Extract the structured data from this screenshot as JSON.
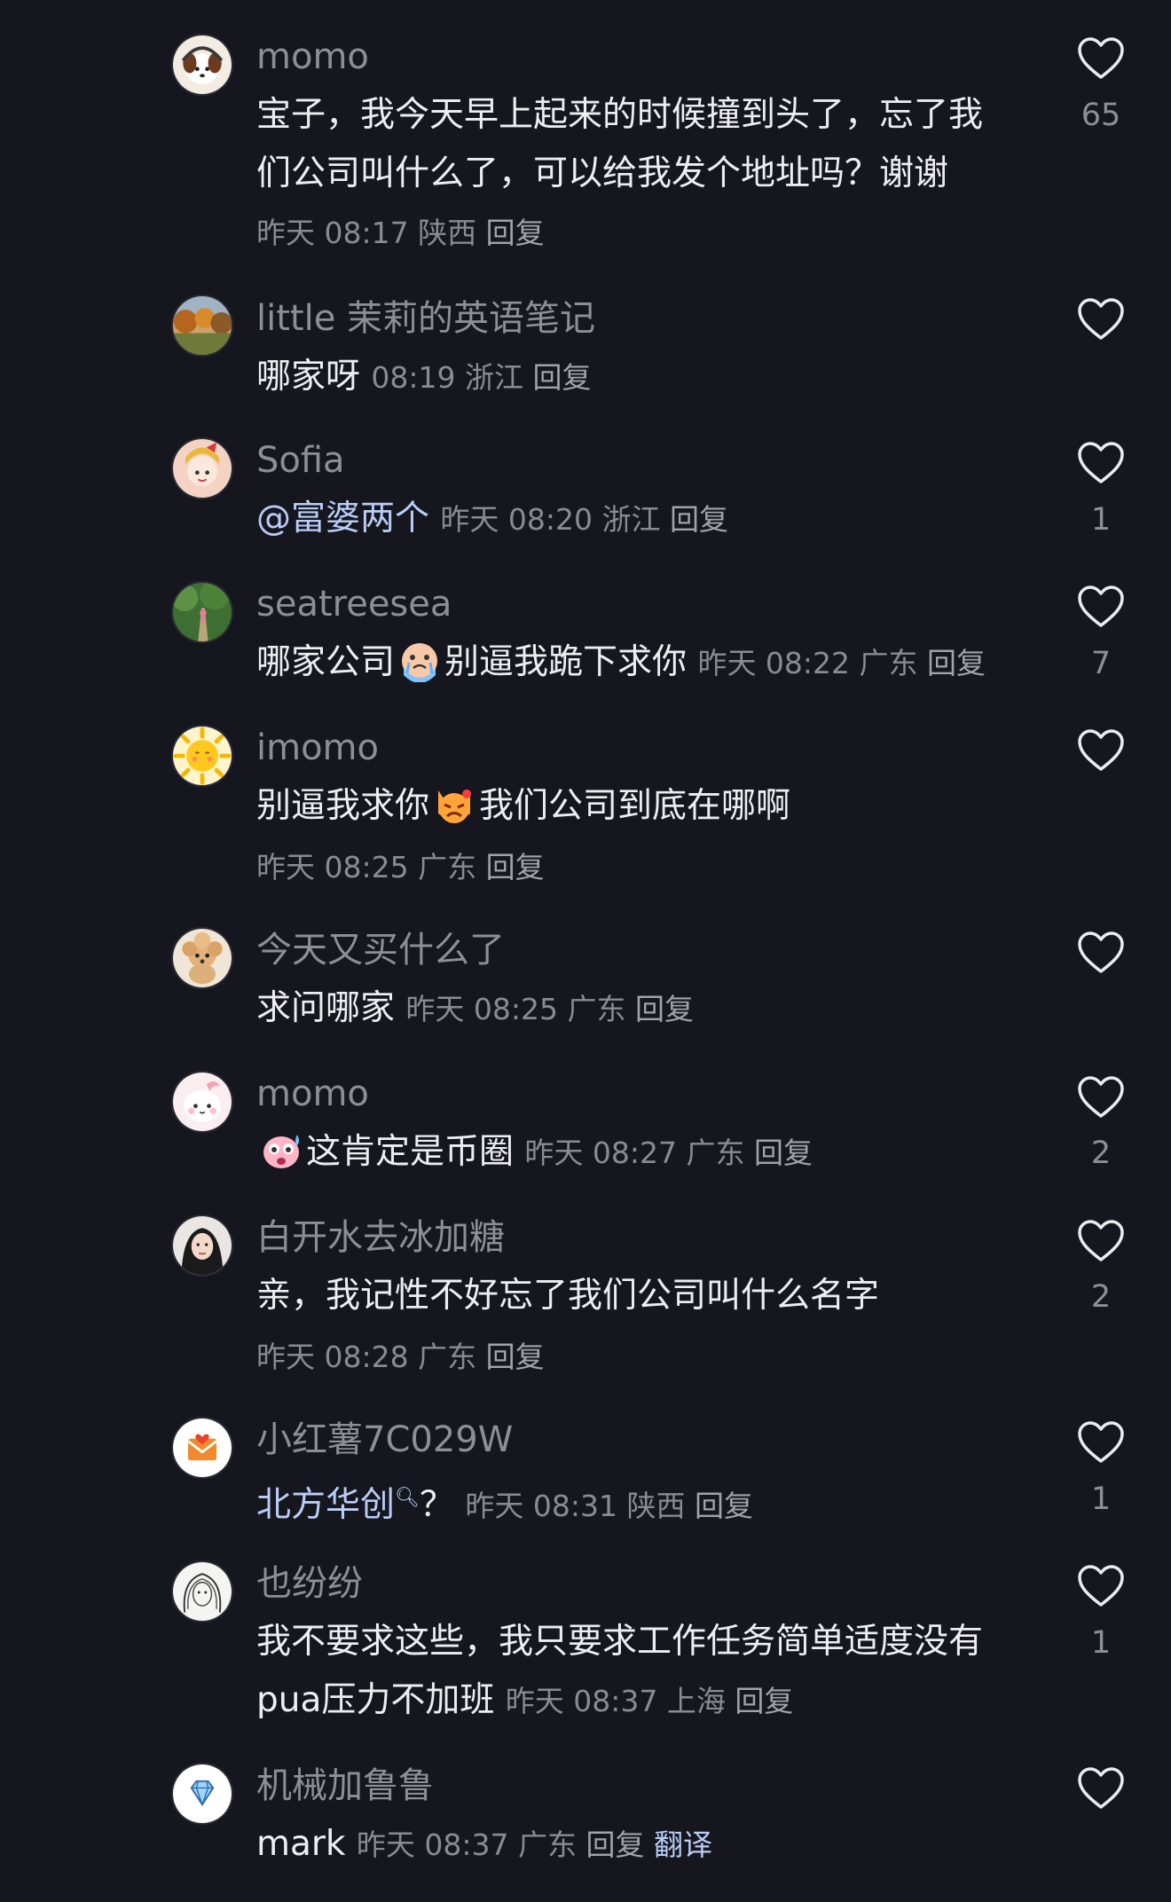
{
  "comments": [
    {
      "username": "momo",
      "text": "宝子，我今天早上起来的时候撞到头了，忘了我们公司叫什么了，可以给我发个地址吗？谢谢",
      "time": "昨天 08:17",
      "location": "陕西",
      "reply": "回复",
      "likes": "65",
      "avatar": "puppy-headphones-avatar"
    },
    {
      "username": "little 茉莉的英语笔记",
      "text": "哪家呀",
      "time": "08:19",
      "location": "浙江",
      "reply": "回复",
      "likes": "",
      "avatar": "autumn-forest-avatar"
    },
    {
      "username": "Sofia",
      "mention": "@富婆两个",
      "time": "昨天 08:20",
      "location": "浙江",
      "reply": "回复",
      "likes": "1",
      "avatar": "cartoon-girl-avatar"
    },
    {
      "username": "seatreesea",
      "text_before": "哪家公司",
      "emoji": "crying-emoji",
      "text_after": "别逼我跪下求你",
      "time": "昨天 08:22",
      "location": "广东",
      "reply": "回复",
      "likes": "7",
      "avatar": "forest-path-avatar"
    },
    {
      "username": "imomo",
      "text_before": "别逼我求你",
      "emoji": "angry-cat-emoji",
      "text_after": "我们公司到底在哪啊",
      "time": "昨天 08:25",
      "location": "广东",
      "reply": "回复",
      "likes": "",
      "avatar": "sun-avatar"
    },
    {
      "username": "今天又买什么了",
      "text": "求问哪家",
      "time": "昨天 08:25",
      "location": "广东",
      "reply": "回复",
      "likes": "",
      "avatar": "poodle-avatar"
    },
    {
      "username": "momo",
      "emoji": "sweating-emoji",
      "text": "这肯定是币圈",
      "time": "昨天 08:27",
      "location": "广东",
      "reply": "回复",
      "likes": "2",
      "avatar": "pink-blob-avatar"
    },
    {
      "username": "白开水去冰加糖",
      "text": "亲，我记性不好忘了我们公司叫什么名字",
      "time": "昨天 08:28",
      "location": "广东",
      "reply": "回复",
      "likes": "2",
      "avatar": "woman-portrait-avatar"
    },
    {
      "username": "小红薯7C029W",
      "keyword": "北方华创",
      "keyword_suffix": "？",
      "time": "昨天 08:31",
      "location": "陕西",
      "reply": "回复",
      "likes": "1",
      "avatar": "envelope-heart-avatar"
    },
    {
      "username": "也纷纷",
      "text": "我不要求这些，我只要求工作任务简单适度没有pua压力不加班",
      "time": "昨天 08:37",
      "location": "上海",
      "reply": "回复",
      "likes": "1",
      "avatar": "sketch-portrait-avatar"
    },
    {
      "username": "机械加鲁鲁",
      "text": "mark",
      "time": "昨天 08:37",
      "location": "广东",
      "reply": "回复",
      "translate": "翻译",
      "likes": "",
      "avatar": "diamond-avatar"
    }
  ]
}
